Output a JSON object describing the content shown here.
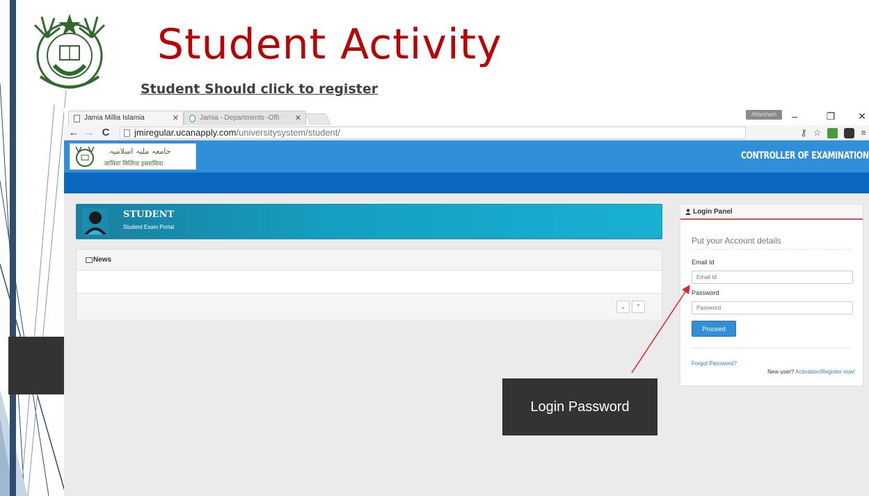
{
  "slide": {
    "title": "Student Activity",
    "subtitle": "Student Should click to register"
  },
  "browser": {
    "tabs": [
      {
        "label": "Jamia Millia Islamia",
        "active": true
      },
      {
        "label": "Jamia - Departments -Offi",
        "active": false
      }
    ],
    "user_badge": "Ahtesham",
    "url_host": "jmiregular.ucanapply.com",
    "url_path": "/universitysystem/student/",
    "window_buttons": [
      "–",
      "❐",
      "✕"
    ]
  },
  "site": {
    "logo_urdu": "جامعہ ملیہ اسلامیہ",
    "logo_hindi": "जामिया मिलिया इस्लामिया",
    "controller": "CONTROLLER OF EXAMINATION"
  },
  "student_banner": {
    "title": "STUDENT",
    "subtitle": "Student Exam Portal"
  },
  "news": {
    "title": "News",
    "down_btn": "⌄",
    "up_btn": "⌃"
  },
  "login": {
    "panel_title": "Login Panel",
    "lead": "Put your Account details",
    "email_label": "Email Id",
    "email_placeholder": "Email Id",
    "password_label": "Password",
    "password_placeholder": "Password",
    "proceed": "Proceed",
    "forgot": "Forgot Password?",
    "newuser_text": "New user?",
    "register_link": "Activation/Register now!"
  },
  "annotation": {
    "callout": "Login Password"
  },
  "colors": {
    "title_red": "#c00000",
    "header_blue": "#2f8fd8",
    "nav_blue": "#0a68c0",
    "banner_teal": "#14a0c2",
    "callout_bg": "#333333",
    "arrow_red": "#ee1c24"
  }
}
